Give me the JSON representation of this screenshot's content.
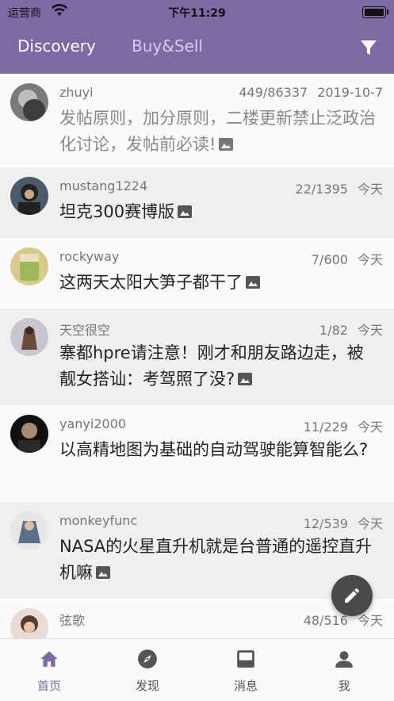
{
  "status_bar": {
    "carrier": "运营商",
    "time": "下午11:29"
  },
  "header": {
    "tabs": [
      {
        "label": "Discovery"
      },
      {
        "label": "Buy&Sell"
      }
    ],
    "filter_icon": "filter-icon"
  },
  "posts": [
    {
      "user": "zhuyi",
      "counts": "449/86337",
      "date": "2019-10-7",
      "title": "发帖原则，加分原则，二楼更新禁止泛政治化讨论，发帖前必读!",
      "has_image": true
    },
    {
      "user": "mustang1224",
      "counts": "22/1395",
      "date": "今天",
      "title": "坦克300赛博版",
      "has_image": true
    },
    {
      "user": "rockyway",
      "counts": "7/600",
      "date": "今天",
      "title": "这两天太阳大笋子都干了",
      "has_image": true
    },
    {
      "user": "天空很空",
      "counts": "1/82",
      "date": "今天",
      "title": "寨都hpre请注意！刚才和朋友路边走，被靓女搭讪：考驾照了没?",
      "has_image": true
    },
    {
      "user": "yanyi2000",
      "counts": "11/229",
      "date": "今天",
      "title": "以高精地图为基础的自动驾驶能算智能么?",
      "has_image": false
    },
    {
      "user": "monkeyfunc",
      "counts": "12/539",
      "date": "今天",
      "title": "NASA的火星直升机就是台普通的遥控直升机嘛",
      "has_image": true
    },
    {
      "user": "弦歌",
      "counts": "48/516",
      "date": "今天",
      "title": "",
      "has_image": false
    }
  ],
  "bottom_nav": [
    {
      "label": "首页"
    },
    {
      "label": "发现"
    },
    {
      "label": "消息"
    },
    {
      "label": "我"
    }
  ],
  "colors": {
    "primary": "#7b6aa4",
    "fab": "#4a4a4a"
  }
}
